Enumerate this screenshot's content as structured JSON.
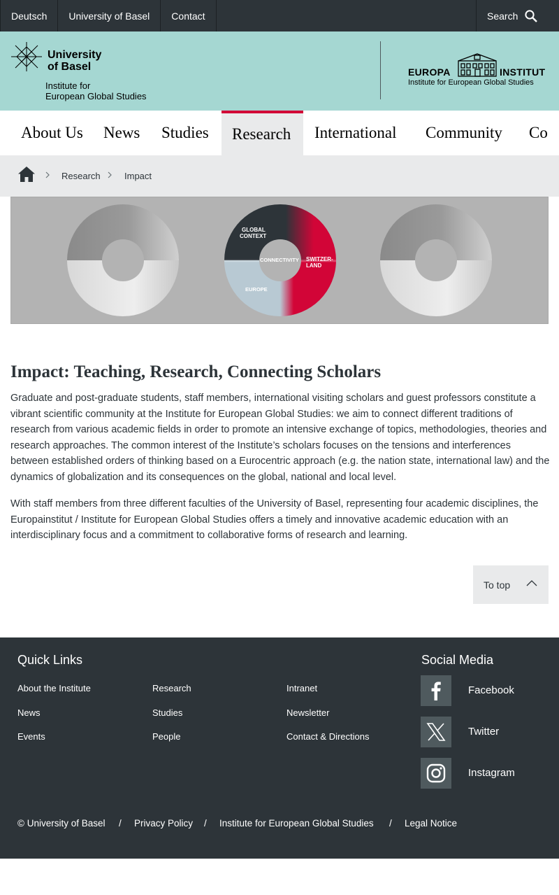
{
  "topbar": {
    "links": [
      "Deutsch",
      "University of Basel",
      "Contact"
    ],
    "search_label": "Search"
  },
  "header": {
    "university_line1": "University",
    "university_line2": "of Basel",
    "institute_line1": "Institute for",
    "institute_line2": "European Global Studies",
    "europa_word": "EUROPA",
    "institut_word": "INSTITUT",
    "europa_subtitle": "Institute for European Global Studies"
  },
  "nav": {
    "items": [
      "About Us",
      "News",
      "Studies",
      "Research",
      "International",
      "Community",
      "Co"
    ],
    "active": "Research"
  },
  "breadcrumb": {
    "items": [
      "Research",
      "Impact"
    ]
  },
  "hero": {
    "labels": {
      "global_context_1": "GLOBAL",
      "global_context_2": "CONTEXT",
      "connectivity": "CONNECTIVITY",
      "switzerland_1": "SWITZER-",
      "switzerland_2": "LAND",
      "europe": "EUROPE"
    },
    "colors": {
      "red": "#d20537",
      "dark": "#2d3439",
      "light_blue": "#b8c9d3",
      "gray_bg": "#b3b3b3"
    }
  },
  "article": {
    "title": "Impact: Teaching, Research, Connecting Scholars",
    "paragraph1": "Graduate and post-graduate students, staff members, international visiting scholars and guest professors constitute a vibrant scientific community at the Institute for European Global Studies: we aim to connect different traditions of research from various academic fields in order to promote an intensive exchange of topics, methodologies, theories and research approaches. The common interest of the Institute’s scholars focuses on the tensions and interferences between established orders of thinking based on a Eurocentric approach (e.g. the nation state, international law) and the dynamics of globalization and its consequences on the global, national and local level.",
    "paragraph2": "With staff members from three different faculties of the University of Basel, representing four academic disciplines, the Europainstitut / Institute for European Global Studies offers a timely and innovative academic education with an interdisciplinary focus and a commitment to collaborative forms of research and learning."
  },
  "to_top_label": "To top",
  "footer": {
    "quick_links_title": "Quick Links",
    "quick_links": {
      "col1": [
        "About the Institute",
        "News",
        "Events"
      ],
      "col2": [
        "Research",
        "Studies",
        "People"
      ],
      "col3": [
        "Intranet",
        "Newsletter",
        "Contact & Directions"
      ]
    },
    "social_title": "Social Media",
    "social": [
      "Facebook",
      "Twitter",
      "Instagram"
    ],
    "legal": [
      "© University of Basel",
      "/",
      "Privacy Policy",
      "/",
      "Institute for European Global Studies",
      "/",
      "Legal Notice"
    ]
  }
}
